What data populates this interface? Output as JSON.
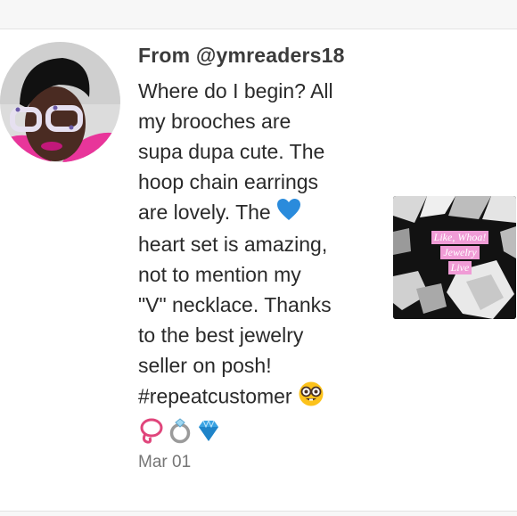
{
  "comment": {
    "from_label": "From @ymreaders18",
    "review_lines": [
      "Where do I begin? All",
      "my brooches are",
      "supa dupa cute. The",
      "hoop chain earrings",
      "are lovely. The",
      "heart set is amazing,",
      "not to mention my",
      "\"V\" necklace. Thanks",
      "to the best jewelry",
      "seller on posh!",
      "#repeatcustomer"
    ],
    "emojis": [
      "blue-heart-icon",
      "nerd-face-icon",
      "lasso-icon",
      "ring-icon",
      "gem-icon"
    ],
    "date": "Mar 01"
  },
  "thumbnail": {
    "caption_lines": [
      "Like, Whoa!",
      "Jewelry",
      "Live"
    ]
  },
  "colors": {
    "caption_bg": "#f09cd6",
    "heart": "#2a8bdc"
  }
}
